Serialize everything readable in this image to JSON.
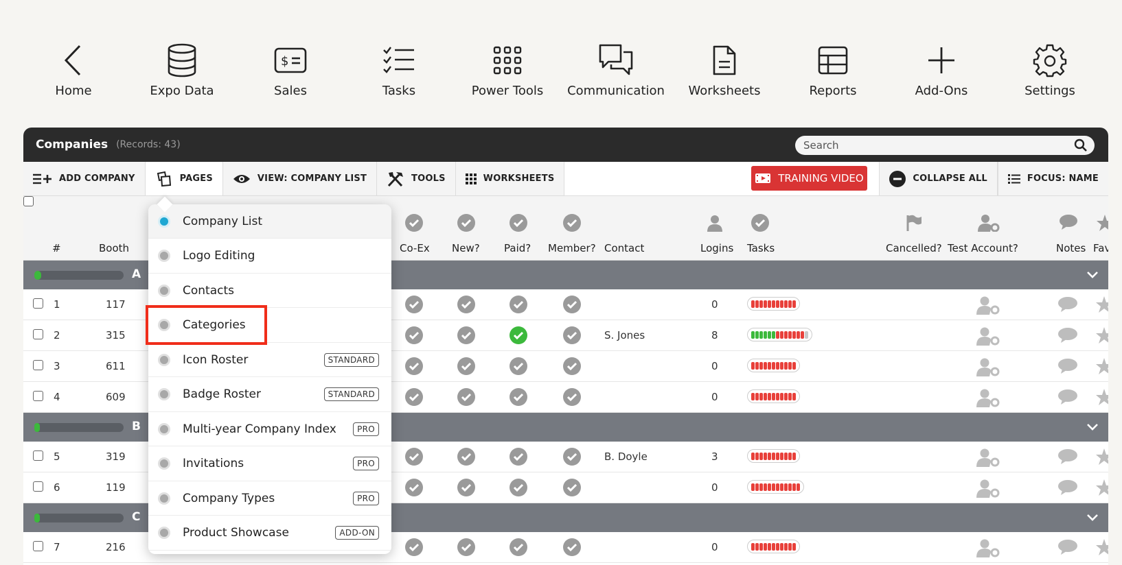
{
  "nav": {
    "home": "Home",
    "expo_data": "Expo Data",
    "sales": "Sales",
    "tasks": "Tasks",
    "power_tools": "Power Tools",
    "communication": "Communication",
    "worksheets": "Worksheets",
    "reports": "Reports",
    "add_ons": "Add-Ons",
    "settings": "Settings"
  },
  "panel": {
    "title": "Companies",
    "records": "(Records: 43)",
    "search_placeholder": "Search"
  },
  "toolbar": {
    "add_company": "ADD COMPANY",
    "pages": "PAGES",
    "view": "VIEW: COMPANY LIST",
    "tools": "TOOLS",
    "worksheets": "WORKSHEETS",
    "training_video": "TRAINING VIDEO",
    "collapse_all": "COLLAPSE ALL",
    "focus": "FOCUS: NAME"
  },
  "columns": {
    "num": "#",
    "booth": "Booth",
    "coex": "Co-Ex",
    "new": "New?",
    "paid": "Paid?",
    "member": "Member?",
    "contact": "Contact",
    "logins": "Logins",
    "tasks": "Tasks",
    "cancelled": "Cancelled?",
    "test_account": "Test Account?",
    "notes": "Notes",
    "favs": "Favs"
  },
  "groups": [
    {
      "letter": "A",
      "progress": 0.08
    },
    {
      "letter": "B",
      "progress": 0.04
    },
    {
      "letter": "C",
      "progress": 0.04
    }
  ],
  "rows": [
    {
      "num": "1",
      "booth": "117",
      "contact": "",
      "logins": "0",
      "paid": false
    },
    {
      "num": "2",
      "booth": "315",
      "contact": "S. Jones",
      "logins": "8",
      "paid": true
    },
    {
      "num": "3",
      "booth": "611",
      "contact": "",
      "logins": "0",
      "paid": false
    },
    {
      "num": "4",
      "booth": "609",
      "contact": "",
      "logins": "0",
      "paid": false
    },
    {
      "num": "5",
      "booth": "319",
      "contact": "B. Doyle",
      "logins": "3",
      "paid": false
    },
    {
      "num": "6",
      "booth": "119",
      "contact": "",
      "logins": "0",
      "paid": false
    },
    {
      "num": "7",
      "booth": "216",
      "contact": "",
      "logins": "0",
      "paid": false
    }
  ],
  "pages_menu": [
    {
      "label": "Company List",
      "tag": "",
      "active": true
    },
    {
      "label": "Logo Editing",
      "tag": ""
    },
    {
      "label": "Contacts",
      "tag": ""
    },
    {
      "label": "Categories",
      "tag": ""
    },
    {
      "label": "Icon Roster",
      "tag": "STANDARD"
    },
    {
      "label": "Badge Roster",
      "tag": "STANDARD"
    },
    {
      "label": "Multi-year Company Index",
      "tag": "PRO"
    },
    {
      "label": "Invitations",
      "tag": "PRO"
    },
    {
      "label": "Company Types",
      "tag": "PRO"
    },
    {
      "label": "Product Showcase",
      "tag": "ADD-ON"
    }
  ],
  "colors": {
    "accent_red": "#d93434",
    "active_dot": "#1ea7d2",
    "paid_green": "#3cb93c",
    "highlight": "#f02d1a"
  }
}
